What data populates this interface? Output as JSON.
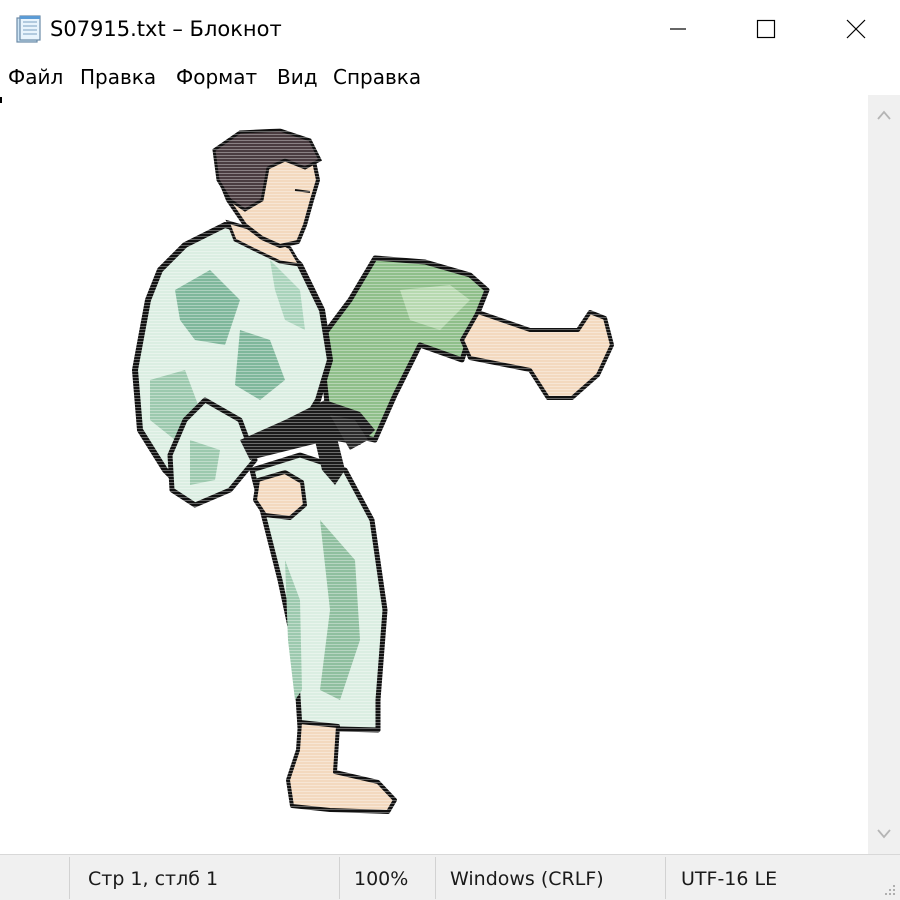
{
  "window": {
    "title": "S07915.txt – Блокнот",
    "icon": "notepad-icon"
  },
  "title_buttons": {
    "minimize_icon": "minimize-icon",
    "maximize_icon": "maximize-icon",
    "close_icon": "close-icon"
  },
  "menu": {
    "items": [
      "Файл",
      "Правка",
      "Формат",
      "Вид",
      "Справка"
    ]
  },
  "editor": {
    "content_image": "karate-kick-clipart",
    "colors": {
      "gi_light": "#dbeee2",
      "gi_mid": "#7fb79b",
      "pants": "#8fbf8a",
      "skin": "#f3d9bf",
      "hair": "#4a3c40",
      "belt": "#1a1a1a"
    }
  },
  "scrollbar": {
    "up_icon": "scroll-up-arrow-icon",
    "down_icon": "scroll-down-arrow-icon"
  },
  "statusbar": {
    "position": "Стр 1, стлб 1",
    "zoom": "100%",
    "line_ending": "Windows (CRLF)",
    "encoding": "UTF-16 LE"
  }
}
